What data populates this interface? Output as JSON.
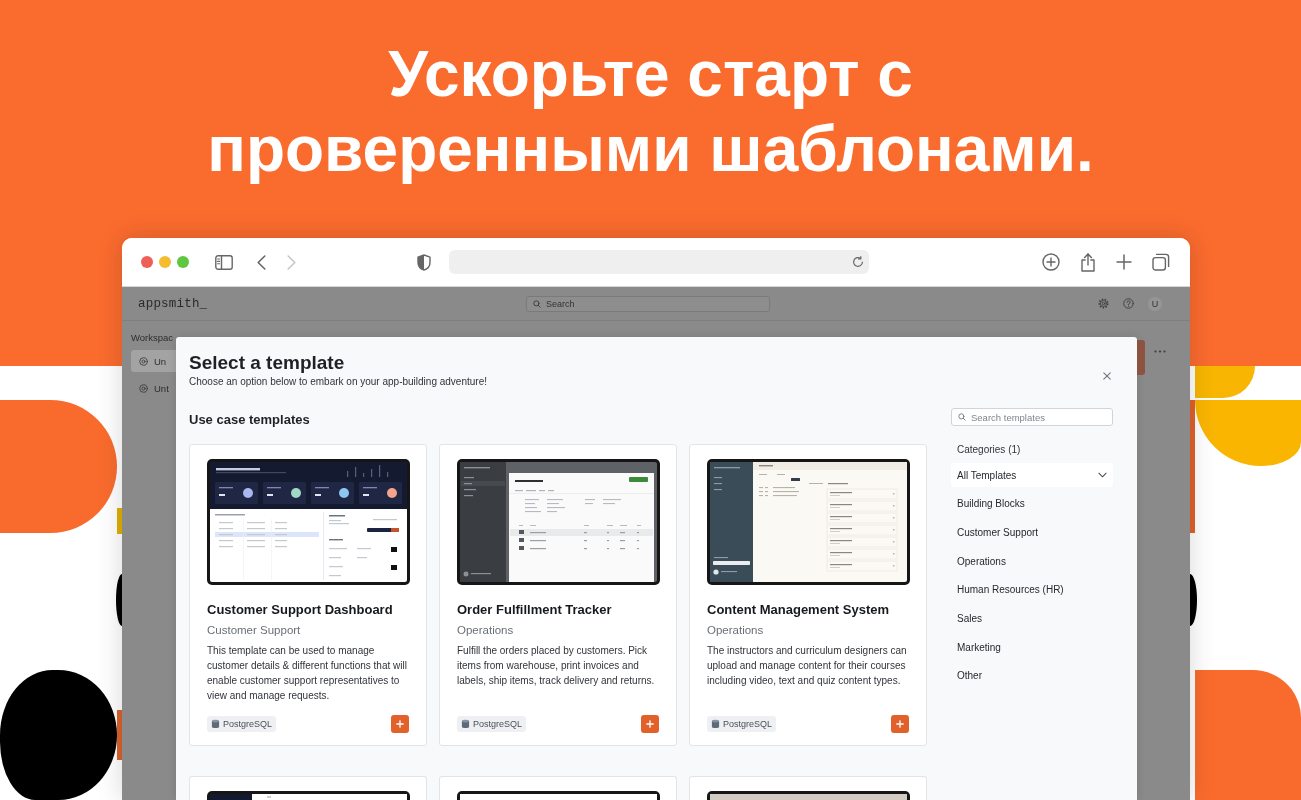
{
  "headline": "Ускорьте старт с проверенными шаблонами.",
  "browser": {
    "back": {
      "disabled": false
    },
    "forward": {
      "disabled": true
    }
  },
  "app": {
    "logo": "appsmith_",
    "search": {
      "placeholder": "Search"
    },
    "avatar": "U",
    "sidebar": {
      "title": "Workspac",
      "items": [
        {
          "label": "Un",
          "selected": true
        },
        {
          "label": "Unt",
          "selected": false
        }
      ]
    }
  },
  "modal": {
    "title": "Select a template",
    "subtitle": "Choose an option below to embark on your app-building adventure!",
    "section_title": "Use case templates",
    "search": {
      "placeholder": "Search templates"
    },
    "categories_title": "Categories (1)",
    "categories": [
      {
        "label": "All Templates",
        "selected": true
      },
      {
        "label": "Building Blocks",
        "selected": false
      },
      {
        "label": "Customer Support",
        "selected": false
      },
      {
        "label": "Operations",
        "selected": false
      },
      {
        "label": "Human Resources (HR)",
        "selected": false
      },
      {
        "label": "Sales",
        "selected": false
      },
      {
        "label": "Marketing",
        "selected": false
      },
      {
        "label": "Other",
        "selected": false
      }
    ],
    "templates": [
      {
        "kind": "dashboard",
        "title": "Customer Support Dashboard",
        "category": "Customer Support",
        "description": "This template can be used to manage customer details & different functions that will enable customer support representatives to view and manage requests.",
        "datasource": "PostgreSQL"
      },
      {
        "kind": "orders",
        "title": "Order Fulfillment Tracker",
        "category": "Operations",
        "description": "Fulfill the orders placed by customers. Pick items from warehouse, print invoices and labels, ship items, track delivery and returns.",
        "datasource": "PostgreSQL"
      },
      {
        "kind": "cms",
        "title": "Content Management System",
        "category": "Operations",
        "description": "The instructors and curriculum designers can upload and manage content for their courses including video, text and quiz content types.",
        "datasource": "PostgreSQL"
      }
    ],
    "more_templates": [
      {
        "kind": "navy-split"
      },
      {
        "kind": "plain"
      },
      {
        "kind": "stone"
      }
    ]
  }
}
